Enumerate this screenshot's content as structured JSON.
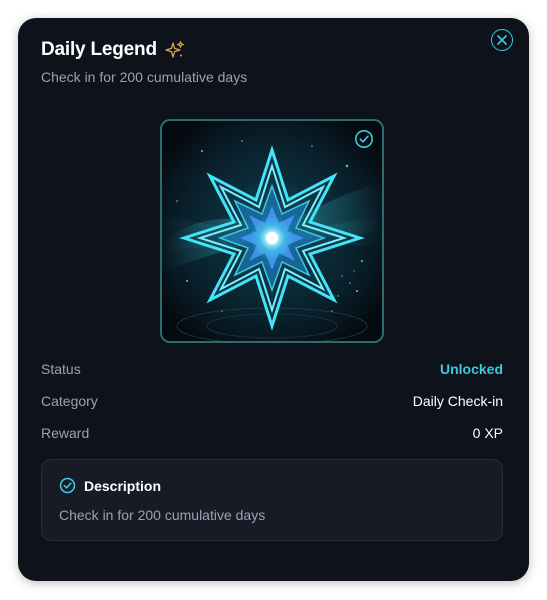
{
  "dialog": {
    "title": "Daily Legend",
    "subtitle": "Check in for 200 cumulative days",
    "title_icon": "sparkles-icon",
    "close_icon": "close-icon"
  },
  "badge": {
    "image": "star-badge",
    "unlocked_icon": "check-circle-icon"
  },
  "details": [
    {
      "label": "Status",
      "value": "Unlocked"
    },
    {
      "label": "Category",
      "value": "Daily Check-in"
    },
    {
      "label": "Reward",
      "value": "0 XP"
    }
  ],
  "description": {
    "heading": "Description",
    "icon": "check-circle-icon",
    "text": "Check in for 200 cumulative days"
  },
  "colors": {
    "accent": "#3ec9df",
    "sparkle": "#d9a64a",
    "background": "#0e121b",
    "card": "#161b26"
  }
}
